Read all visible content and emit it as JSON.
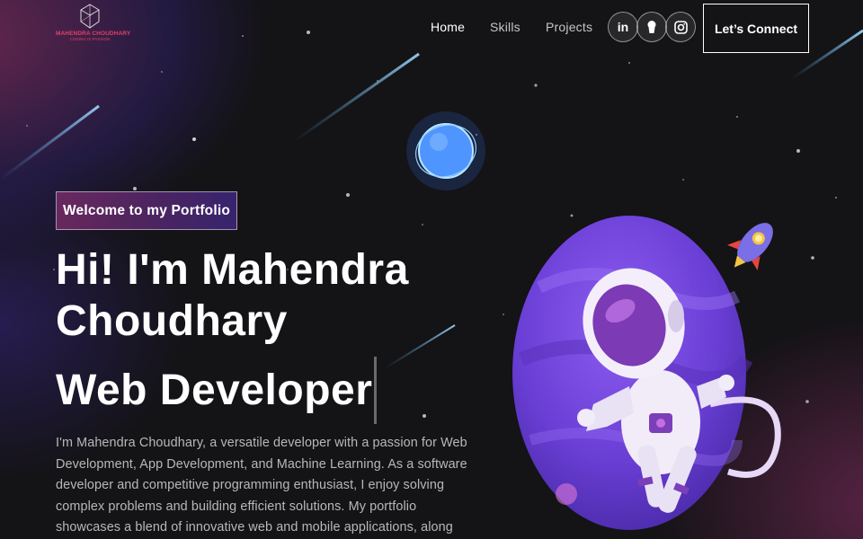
{
  "brand": {
    "name": "MAHENDRA CHOUDHARY",
    "tagline": "CODING IS PASSION"
  },
  "nav": {
    "links": [
      {
        "label": "Home",
        "active": true
      },
      {
        "label": "Skills",
        "active": false
      },
      {
        "label": "Projects",
        "active": false
      }
    ],
    "social": [
      {
        "icon": "linkedin-icon",
        "text": "in"
      },
      {
        "icon": "github-icon"
      },
      {
        "icon": "instagram-icon"
      }
    ],
    "cta_label": "Let’s Connect"
  },
  "hero": {
    "tagline": "Welcome to my Portfolio",
    "greeting_line1": "Hi! I'm Mahendra",
    "greeting_line2": "Choudhary",
    "role": "Web Developer",
    "description": "I'm Mahendra Choudhary, a versatile developer with a passion for Web Development, App Development, and Machine Learning. As a software developer and competitive programming enthusiast, I enjoy solving complex problems and building efficient solutions. My portfolio showcases a blend of innovative web and mobile applications, along with projects that reflect my"
  },
  "theme": {
    "accent_pink": "#AA367C",
    "accent_purple": "#4A2FBD",
    "background": "#121212"
  }
}
